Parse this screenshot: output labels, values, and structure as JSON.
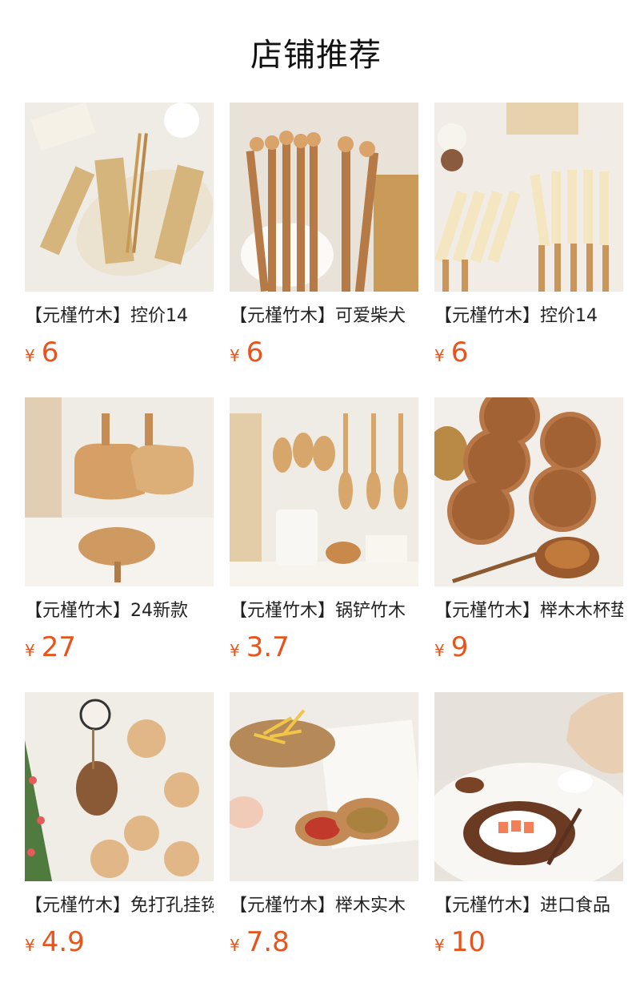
{
  "section": {
    "title": "店铺推荐"
  },
  "currency": "¥",
  "products": [
    {
      "name": "【元槿竹木】控价14",
      "price": "6",
      "image": "chopsticks-gift-box"
    },
    {
      "name": "【元槿竹木】可爱柴犬",
      "price": "6",
      "image": "animal-chopsticks-basket"
    },
    {
      "name": "【元槿竹木】控价14",
      "price": "6",
      "image": "cartoon-chopsticks-set"
    },
    {
      "name": "【元槿竹木】24新款",
      "price": "27",
      "image": "cat-shaped-cutting-boards"
    },
    {
      "name": "【元槿竹木】锅铲竹木",
      "price": "3.7",
      "image": "wooden-spatulas-holder"
    },
    {
      "name": "【元槿竹木】榉木木杯垫",
      "price": "9",
      "image": "engraved-wooden-coasters"
    },
    {
      "name": "【元槿竹木】免打孔挂钩",
      "price": "4.9",
      "image": "animal-wall-hooks"
    },
    {
      "name": "【元槿竹木】榉木实木",
      "price": "7.8",
      "image": "animal-sauce-dishes"
    },
    {
      "name": "【元槿竹木】进口食品",
      "price": "10",
      "image": "walnut-serving-tray"
    }
  ]
}
